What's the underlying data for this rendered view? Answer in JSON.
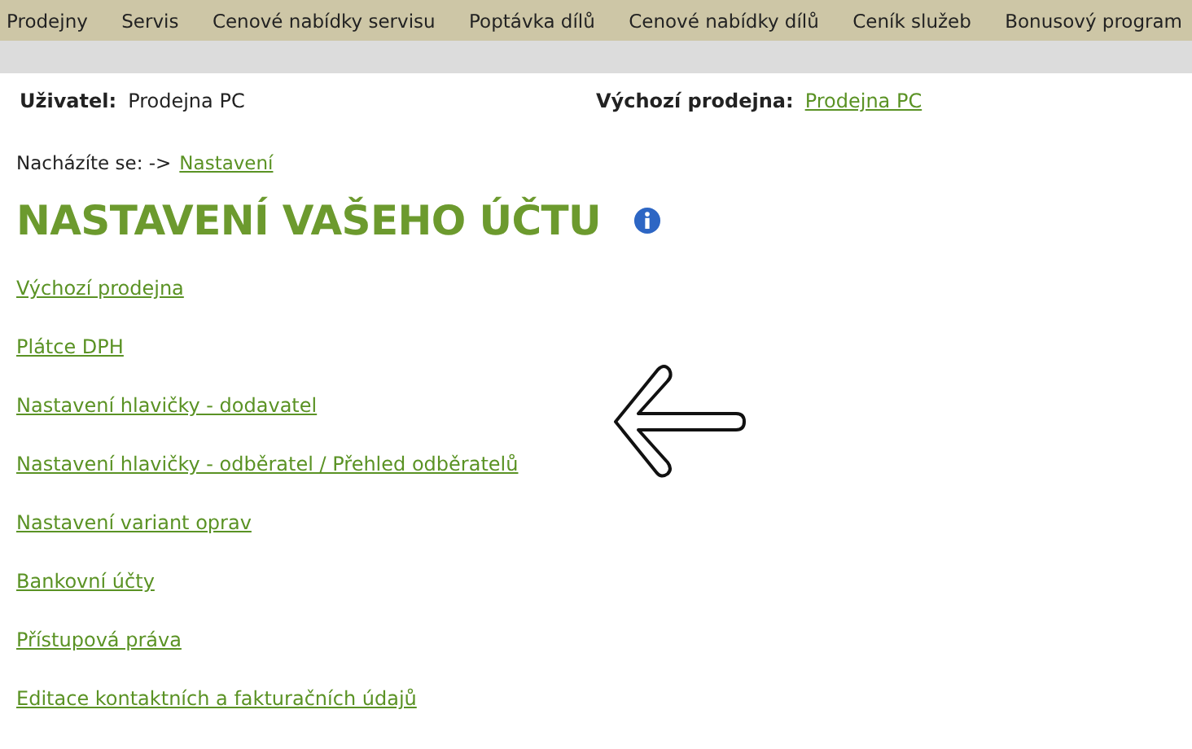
{
  "nav": {
    "items": [
      "Prodejny",
      "Servis",
      "Cenové nabídky servisu",
      "Poptávka dílů",
      "Cenové nabídky dílů",
      "Ceník služeb",
      "Bonusový program"
    ]
  },
  "user_bar": {
    "user_label": "Uživatel:",
    "user_value": "Prodejna PC",
    "store_label": "Výchozí prodejna:",
    "store_link": "Prodejna PC"
  },
  "breadcrumb": {
    "label": "Nacházíte se: ->",
    "link": "Nastavení"
  },
  "title": "NASTAVENÍ VAŠEHO ÚČTU",
  "links": [
    "Výchozí prodejna",
    "Plátce DPH",
    "Nastavení hlavičky - dodavatel",
    "Nastavení hlavičky - odběratel / Přehled odběratelů",
    "Nastavení variant oprav",
    "Bankovní účty",
    "Přístupová práva",
    "Editace kontaktních a fakturačních údajů"
  ]
}
